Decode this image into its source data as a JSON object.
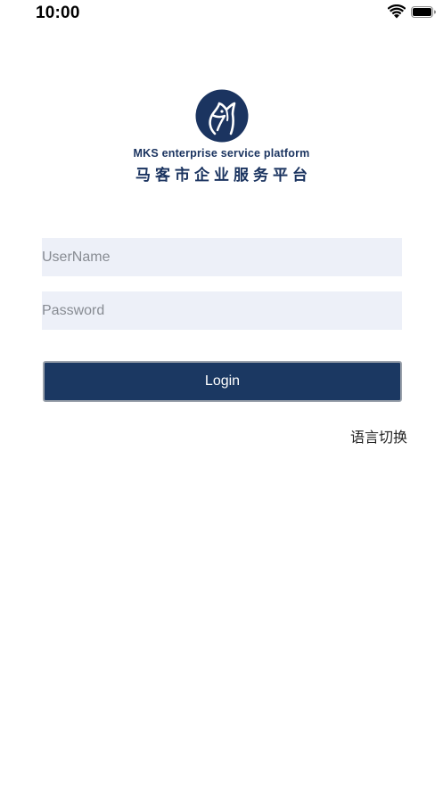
{
  "status_bar": {
    "time": "10:00",
    "icons": [
      "wifi-icon",
      "battery-icon"
    ]
  },
  "logo": {
    "subtitle_en": "MKS enterprise service platform",
    "subtitle_cn": "马客市企业服务平台",
    "brand_color": "#1b3460"
  },
  "form": {
    "username_placeholder": "UserName",
    "username_value": "",
    "password_placeholder": "Password",
    "password_value": "",
    "login_label": "Login",
    "field_background": "#edf0f8",
    "button_color": "#1b3862"
  },
  "language_switch_label": "语言切换"
}
